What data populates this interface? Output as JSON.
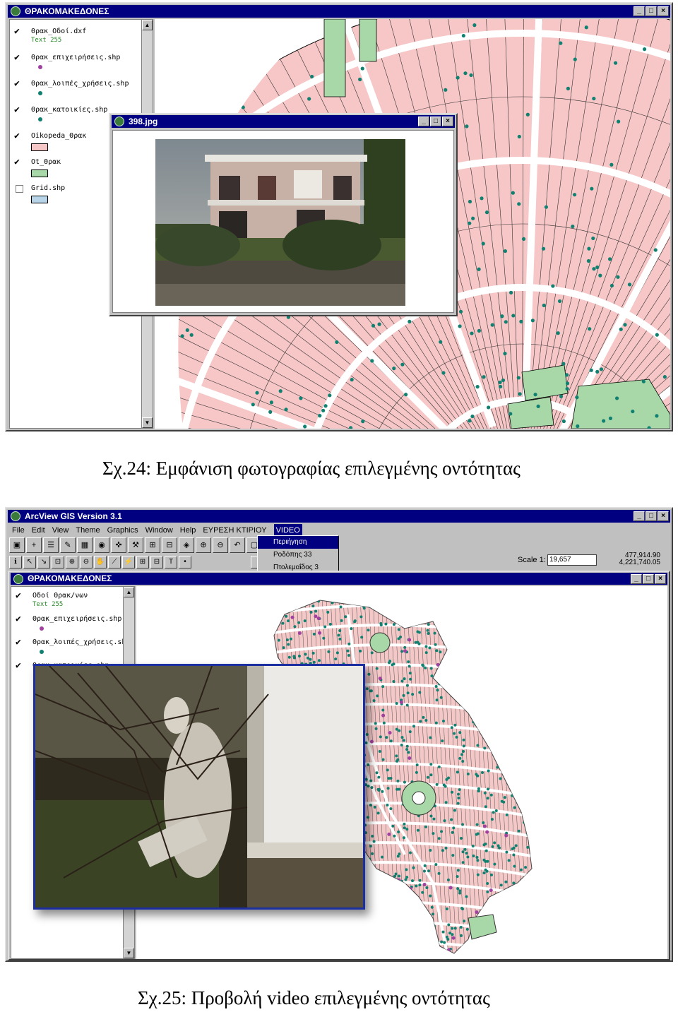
{
  "figure1": {
    "window_title": "ΘΡΑΚΟΜΑΚΕΔΟΝΕΣ",
    "layers": [
      {
        "name": "Θρακ_Οδοί.dxf",
        "checked": true,
        "text": "Text  255"
      },
      {
        "name": "Θρακ_επιχειρήσεις.shp",
        "checked": true,
        "color": "#a040a0"
      },
      {
        "name": "Θρακ_λοιπές_χρήσεις.shp",
        "checked": true,
        "color": "#108070"
      },
      {
        "name": "Θρακ_κατοικίες.shp",
        "checked": true,
        "color": "#108070"
      },
      {
        "name": "Oikopeda_Θρακ",
        "checked": true,
        "color": "#f7c6c6"
      },
      {
        "name": "Ot_Θρακ",
        "checked": true,
        "color": "#a8d8a8"
      },
      {
        "name": "Grid.shp",
        "checked": false,
        "color": "#b8d4e8"
      }
    ],
    "photo_window_title": "398.jpg",
    "caption": "Σχ.24: Εμφάνιση φωτογραφίας επιλεγμένης οντότητας"
  },
  "figure2": {
    "app_title": "ArcView GIS Version 3.1",
    "menus": [
      "File",
      "Edit",
      "View",
      "Theme",
      "Graphics",
      "Window",
      "Help",
      "ΕΥΡΕΣΗ ΚΤΙΡΙΟΥ",
      "VIDEO"
    ],
    "video_menu_items": [
      "Περιήγηση",
      "Ροδόπης 33",
      "Πτολεμαΐδος 3"
    ],
    "scale_label": "Scale 1:",
    "scale_value": "19,657",
    "coord_x": "477,914.90",
    "coord_y": "4,221,740.05",
    "view_title": "ΘΡΑΚΟΜΑΚΕΔΟΝΕΣ",
    "layers": [
      {
        "name": "Οδοί Θρακ/νων",
        "checked": true,
        "text": "Text  255"
      },
      {
        "name": "Θρακ_επιχειρήσεις.shp",
        "checked": true,
        "color": "#a040a0"
      },
      {
        "name": "Θρακ_λοιπές_χρήσεις.shp",
        "checked": true,
        "color": "#108070"
      },
      {
        "name": "Θρακ_κατοικίες.shp",
        "checked": true
      }
    ],
    "caption": "Σχ.25: Προβολή video επιλεγμένης οντότητας"
  }
}
